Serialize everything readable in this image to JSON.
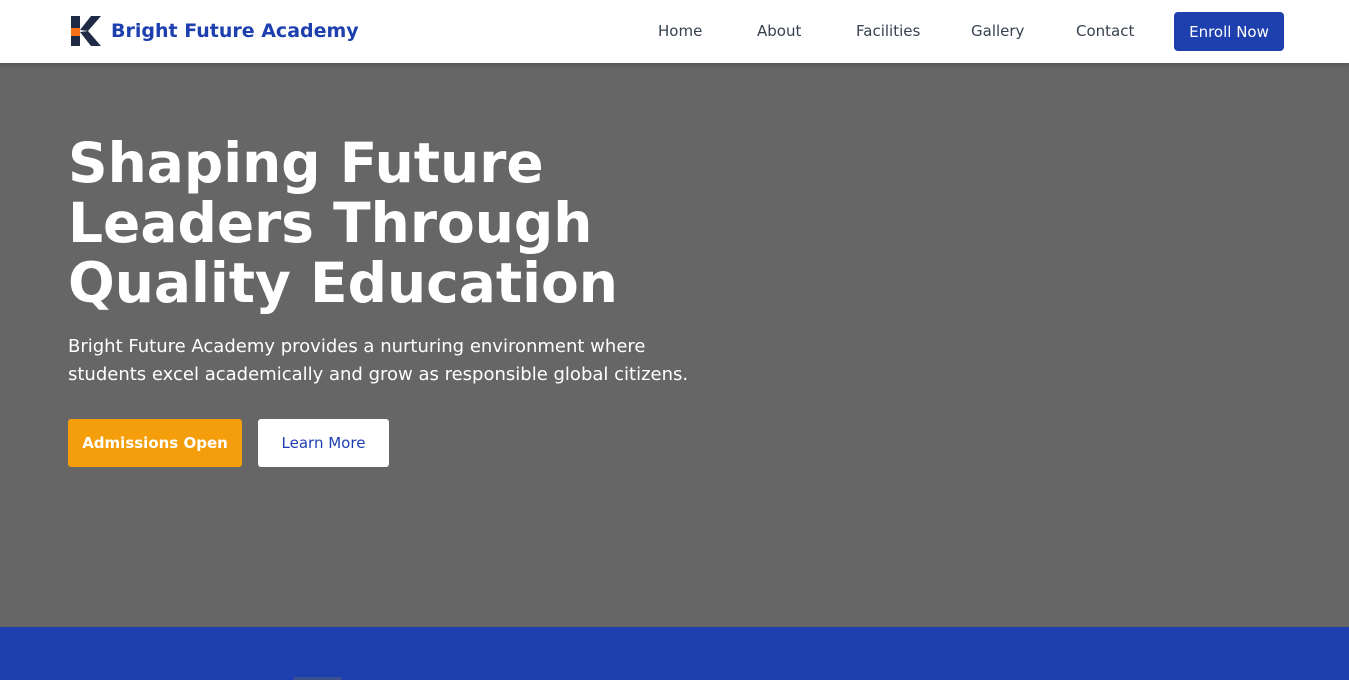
{
  "nav": {
    "brand_name": "Bright Future Academy",
    "logo_icon": "k-logo-icon",
    "links": [
      "Home",
      "About",
      "Facilities",
      "Gallery",
      "Contact"
    ],
    "cta_label": "Enroll Now"
  },
  "hero": {
    "title_lines": [
      "Shaping Future",
      "Leaders Through",
      "Quality Education"
    ],
    "subtitle_lines": [
      "Bright Future Academy provides a nurturing environment where",
      "students excel academically and grow as responsible global citizens."
    ],
    "primary_button": "Admissions Open",
    "secondary_button": "Learn More"
  },
  "colors": {
    "brand_blue": "#1e40af",
    "accent_orange": "#f59e0b",
    "hero_bg": "#666666",
    "nav_text": "#374151"
  }
}
